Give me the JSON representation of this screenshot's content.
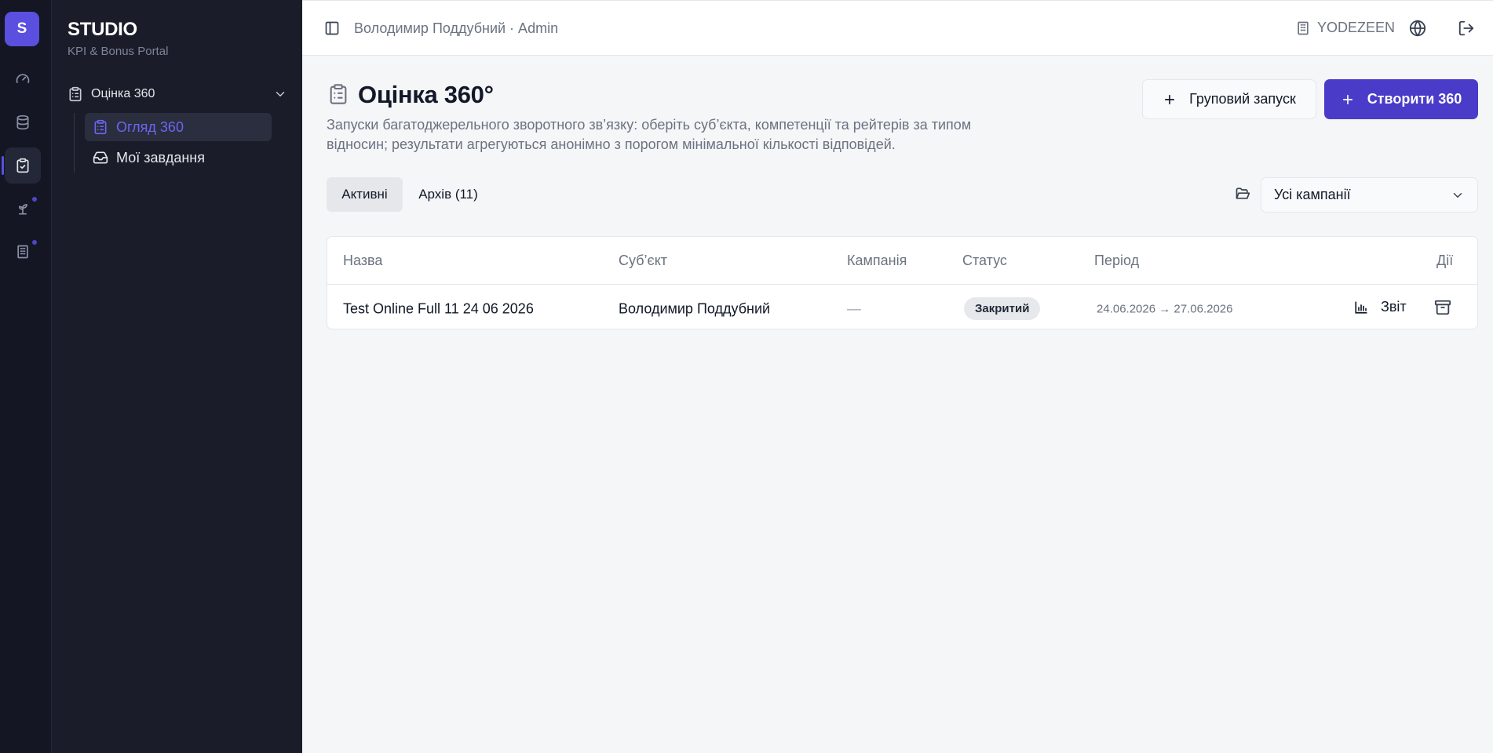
{
  "app": {
    "logo_letter": "S",
    "brand": "STUDIO",
    "brand_sub": "KPI & Bonus Portal"
  },
  "rail": {
    "items": [
      {
        "icon": "speedometer-icon"
      },
      {
        "icon": "database-icon"
      },
      {
        "icon": "clipboard-check-icon",
        "active": true
      },
      {
        "icon": "sprout-icon",
        "dot": true
      },
      {
        "icon": "building-icon",
        "dot": true
      }
    ]
  },
  "sidebar": {
    "group_label": "Оцінка 360",
    "items": [
      {
        "label": "Огляд 360",
        "icon": "clipboard-list-icon",
        "active": true
      },
      {
        "label": "Мої завдання",
        "icon": "inbox-icon"
      }
    ]
  },
  "topbar": {
    "breadcrumb": "Володимир Поддубний · Admin",
    "org": "YODEZEEN"
  },
  "page": {
    "title": "Оцінка 360°",
    "description": "Запуски багатоджерельного зворотного зв’язку: оберіть суб’єкта, компетенції та рейтерів за типом відносин; результати агрегуються анонімно з порогом мінімальної кількості відповідей.",
    "group_launch_label": "Груповий запуск",
    "create_label": "Створити 360"
  },
  "tabs": [
    {
      "label": "Активні",
      "active": true
    },
    {
      "label": "Архів (11)"
    }
  ],
  "filter": {
    "selected": "Усі кампанії"
  },
  "table": {
    "headers": [
      "Назва",
      "Суб’єкт",
      "Кампанія",
      "Статус",
      "Період",
      "Дії"
    ],
    "rows": [
      {
        "name": "Test Online Full 11 24 06 2026",
        "subject": "Володимир Поддубний",
        "campaign": "—",
        "status": "Закритий",
        "period": "24.06.2026 → 27.06.2026",
        "report_label": "Звіт"
      }
    ]
  },
  "colors": {
    "accent": "#4b3bc9",
    "sidebar_bg": "#1a1d29",
    "rail_bg": "#141723"
  }
}
